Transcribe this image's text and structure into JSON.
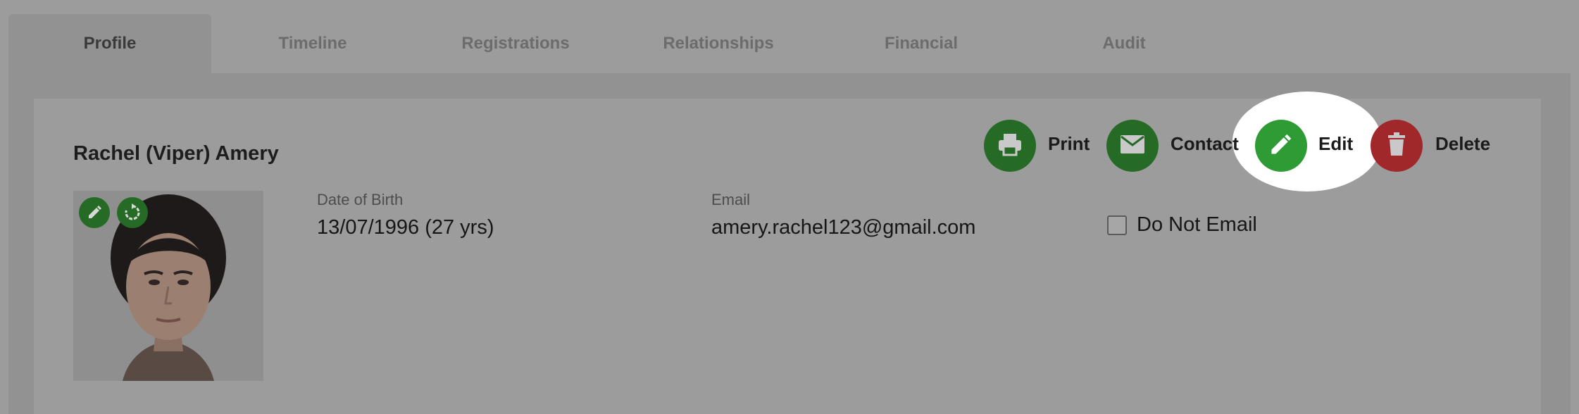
{
  "tabs": [
    {
      "label": "Profile",
      "active": true
    },
    {
      "label": "Timeline",
      "active": false
    },
    {
      "label": "Registrations",
      "active": false
    },
    {
      "label": "Relationships",
      "active": false
    },
    {
      "label": "Financial",
      "active": false
    },
    {
      "label": "Audit",
      "active": false
    }
  ],
  "record": {
    "name": "Rachel (Viper) Amery"
  },
  "fields": {
    "dob_label": "Date of Birth",
    "dob_value": "13/07/1996 (27 yrs)",
    "email_label": "Email",
    "email_value": "amery.rachel123@gmail.com",
    "do_not_email_label": "Do Not Email",
    "do_not_email_checked": false
  },
  "actions": {
    "print": {
      "label": "Print",
      "icon": "printer-icon"
    },
    "contact": {
      "label": "Contact",
      "icon": "envelope-icon"
    },
    "edit": {
      "label": "Edit",
      "icon": "pencil-icon",
      "highlighted": true
    },
    "delete": {
      "label": "Delete",
      "icon": "trash-icon"
    }
  },
  "photo": {
    "edit_icon": "pencil-icon",
    "rotate_icon": "rotate-icon"
  },
  "colors": {
    "overlay_gray": "#9c9c9c",
    "action_green": "#256b25",
    "highlight_green": "#2f9b34",
    "delete_red": "#a0282a",
    "spotlight": "#ffffff"
  }
}
